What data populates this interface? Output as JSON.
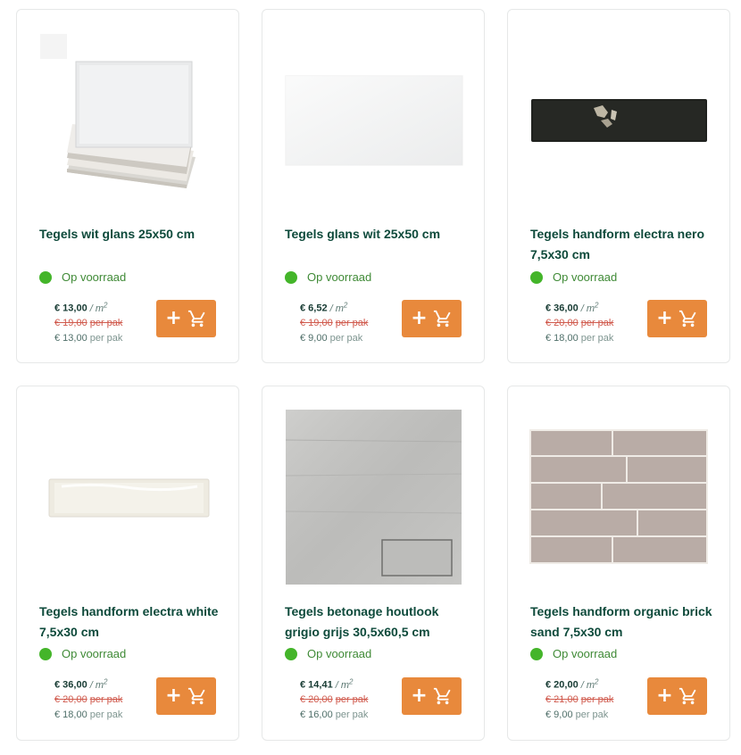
{
  "products": [
    {
      "title": "Tegels wit glans 25x50 cm",
      "stock": "Op voorraad",
      "price": "€ 13,00",
      "price_unit": "/ m",
      "price_unit_sup": "2",
      "old_price": "€ 19,00",
      "old_label": "per pak",
      "pack_price": "€ 13,00",
      "pack_label": "per pak",
      "image_icon": "white-tile-stack-image"
    },
    {
      "title": "Tegels glans wit 25x50 cm",
      "stock": "Op voorraad",
      "price": "€ 6,52",
      "price_unit": "/ m",
      "price_unit_sup": "2",
      "old_price": "€ 19,00",
      "old_label": "per pak",
      "pack_price": "€ 9,00",
      "pack_label": "per pak",
      "image_icon": "white-tile-image"
    },
    {
      "title": "Tegels handform electra nero 7,5x30 cm",
      "stock": "Op voorraad",
      "price": "€ 36,00",
      "price_unit": "/ m",
      "price_unit_sup": "2",
      "old_price": "€ 20,00",
      "old_label": "per pak",
      "pack_price": "€ 18,00",
      "pack_label": "per pak",
      "image_icon": "black-brick-tile-image"
    },
    {
      "title": "Tegels handform electra white 7,5x30 cm",
      "stock": "Op voorraad",
      "price": "€ 36,00",
      "price_unit": "/ m",
      "price_unit_sup": "2",
      "old_price": "€ 20,00",
      "old_label": "per pak",
      "pack_price": "€ 18,00",
      "pack_label": "per pak",
      "image_icon": "white-brick-tile-image"
    },
    {
      "title": "Tegels betonage houtlook grigio grijs 30,5x60,5 cm",
      "stock": "Op voorraad",
      "price": "€ 14,41",
      "price_unit": "/ m",
      "price_unit_sup": "2",
      "old_price": "€ 20,00",
      "old_label": "per pak",
      "pack_price": "€ 16,00",
      "pack_label": "per pak",
      "image_icon": "grey-concrete-tile-image"
    },
    {
      "title": "Tegels handform organic brick sand 7,5x30 cm",
      "stock": "Op voorraad",
      "price": "€ 20,00",
      "price_unit": "/ m",
      "price_unit_sup": "2",
      "old_price": "€ 21,00",
      "old_label": "per pak",
      "pack_price": "€ 9,00",
      "pack_label": "per pak",
      "image_icon": "sand-brick-wall-image"
    }
  ],
  "colors": {
    "title": "#0e4a3b",
    "in_stock": "#44b52a",
    "cart_button": "#e8893c",
    "old_price": "#d05a4d"
  },
  "cart_button_icon": "cart-plus-icon"
}
